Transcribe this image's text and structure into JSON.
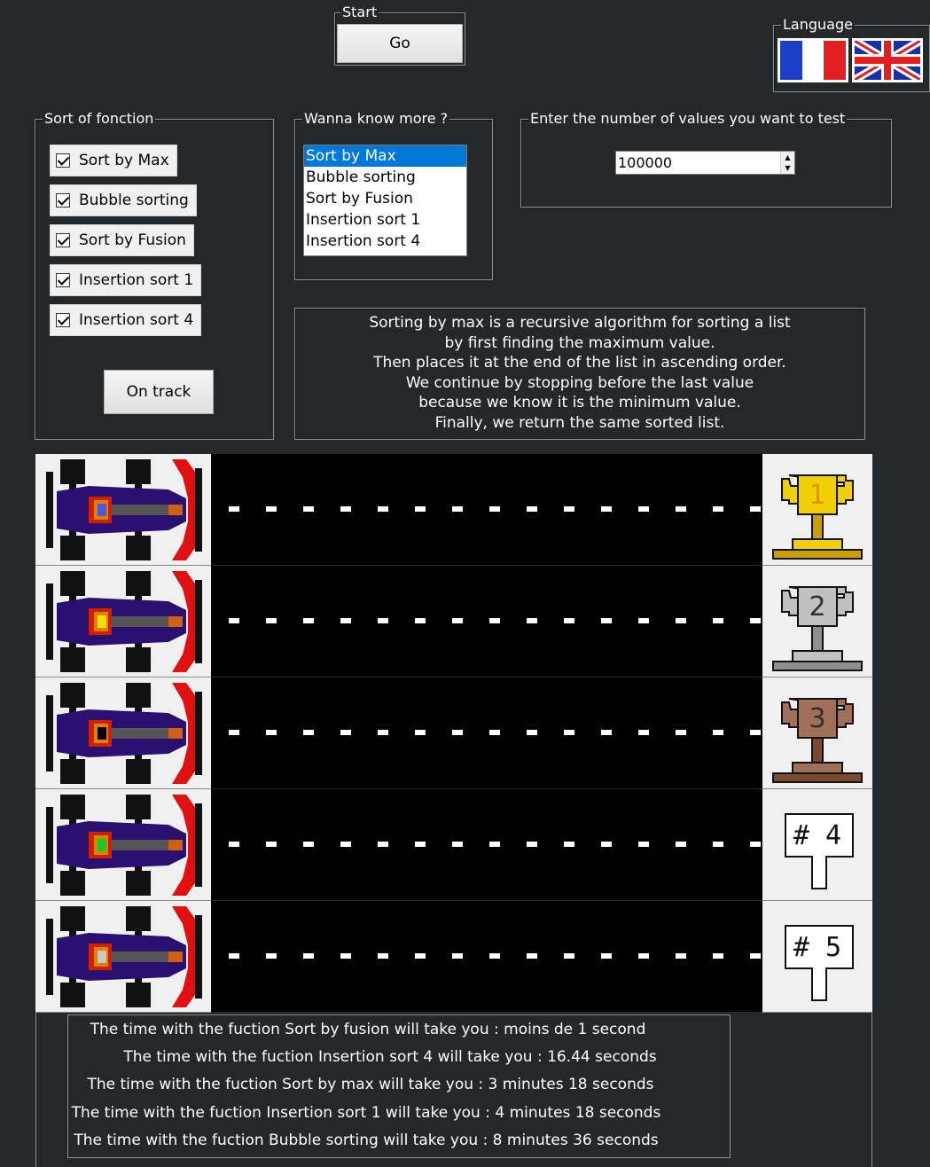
{
  "start_group": {
    "legend": "Start",
    "go_label": "Go"
  },
  "language_group": {
    "legend": "Language",
    "flags": [
      "french-flag-icon",
      "uk-flag-icon"
    ]
  },
  "sort_group": {
    "legend": "Sort of fonction",
    "checkboxes": [
      {
        "label": "Sort by Max",
        "checked": true
      },
      {
        "label": "Bubble sorting",
        "checked": true
      },
      {
        "label": "Sort by Fusion",
        "checked": true
      },
      {
        "label": "Insertion sort 1",
        "checked": true
      },
      {
        "label": "Insertion sort 4",
        "checked": true
      }
    ],
    "on_track_label": "On track"
  },
  "info_group": {
    "legend": "Wanna know more ?",
    "items": [
      "Sort by Max",
      "Bubble sorting",
      "Sort by Fusion",
      "Insertion sort 1",
      "Insertion sort 4"
    ],
    "selected": "Sort by Max"
  },
  "count_group": {
    "legend": "Enter the number of values you want to test",
    "value": "100000"
  },
  "description": {
    "lines": [
      "Sorting by max is a recursive algorithm for sorting a list",
      "by first finding the maximum value.",
      "Then places it at the end of the list in ascending order.",
      "We continue by stopping before the last value",
      "because we know it is the minimum value.",
      "Finally, we return the same sorted list."
    ]
  },
  "race": {
    "lanes": [
      {
        "car_color": "#4a5ad8",
        "trophy": "1",
        "trophy_kind": "gold-trophy-icon"
      },
      {
        "car_color": "#f0e010",
        "trophy": "2",
        "trophy_kind": "silver-trophy-icon"
      },
      {
        "car_color": "#000000",
        "trophy": "3",
        "trophy_kind": "bronze-trophy-icon"
      },
      {
        "car_color": "#18c828",
        "trophy": "# 4",
        "trophy_kind": "rank-4-sign-icon"
      },
      {
        "car_color": "#c8c8c8",
        "trophy": "# 5",
        "trophy_kind": "rank-5-sign-icon"
      }
    ]
  },
  "results": {
    "lines": [
      "The time with the fuction Sort by fusion will take you :  moins de 1  second",
      "The time with the fuction Insertion sort 4 will take you : 16.44 seconds",
      "The time with the fuction Sort by max will take you : 3 minutes 18 seconds",
      "The time with the fuction Insertion sort 1 will take you : 4 minutes 18 seconds",
      "The time with the fuction Bubble sorting  will take you : 8 minutes 36 seconds"
    ]
  },
  "colors": {
    "background": "#24282b",
    "selection": "#0078d7",
    "gold": "#f0d000",
    "silver": "#c0c0c0",
    "bronze": "#a0705a"
  }
}
